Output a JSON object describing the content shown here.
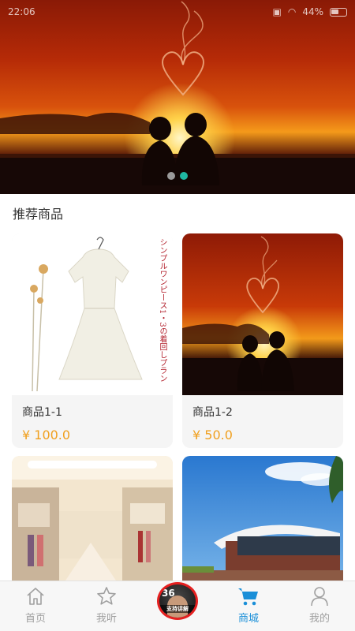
{
  "status_bar": {
    "time": "22:06",
    "battery": "44%"
  },
  "banner": {
    "slides": 2,
    "active_slide": 2
  },
  "section": {
    "title": "推荐商品"
  },
  "products": [
    {
      "name": "商品1-1",
      "price": "¥ 100.0",
      "image": "white-dress",
      "poster_text": "シンプルワンピース1・3の着回しプラン"
    },
    {
      "name": "商品1-2",
      "price": "¥ 50.0",
      "image": "sunset-couple"
    },
    {
      "name": "",
      "price": "",
      "image": "shopping-mall"
    },
    {
      "name": "",
      "price": "",
      "image": "modern-building"
    }
  ],
  "tabbar": {
    "tabs": [
      {
        "label": "首页",
        "icon": "home-icon",
        "active": false
      },
      {
        "label": "我听",
        "icon": "star-icon",
        "active": false
      },
      {
        "label": "",
        "icon": "center-avatar",
        "active": false,
        "avatar_number": "36",
        "avatar_caption": "支持讲解"
      },
      {
        "label": "商城",
        "icon": "cart-icon",
        "active": true
      },
      {
        "label": "我的",
        "icon": "user-icon",
        "active": false
      }
    ]
  },
  "colors": {
    "active_tab": "#1a8fd8",
    "price": "#f0a020",
    "dot_active": "#1fb8a3"
  }
}
